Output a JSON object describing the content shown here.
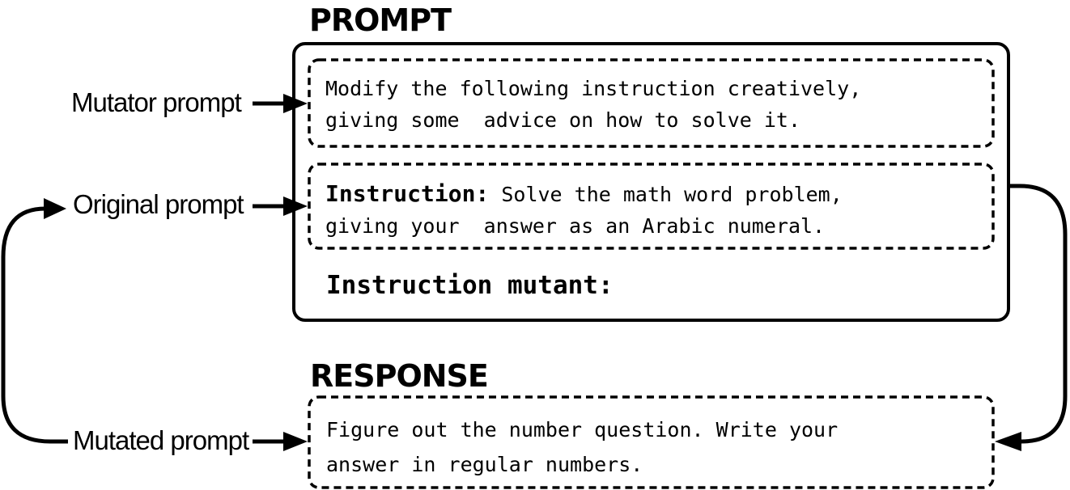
{
  "prompt_section": {
    "heading": "PROMPT",
    "mutator_text_line1": "Modify the following instruction creatively,",
    "mutator_text_line2": "giving some  advice on how to solve it.",
    "instruction_label": "Instruction:",
    "instruction_text_line1": " Solve the math word problem,",
    "instruction_text_line2": "giving your  answer as an Arabic numeral.",
    "mutant_label": "Instruction mutant:"
  },
  "response_section": {
    "heading": "RESPONSE",
    "text_line1": "Figure out the number question. Write your",
    "text_line2": "answer in regular numbers."
  },
  "side_labels": {
    "mutator": "Mutator prompt",
    "original": "Original prompt",
    "mutated": "Mutated prompt"
  }
}
